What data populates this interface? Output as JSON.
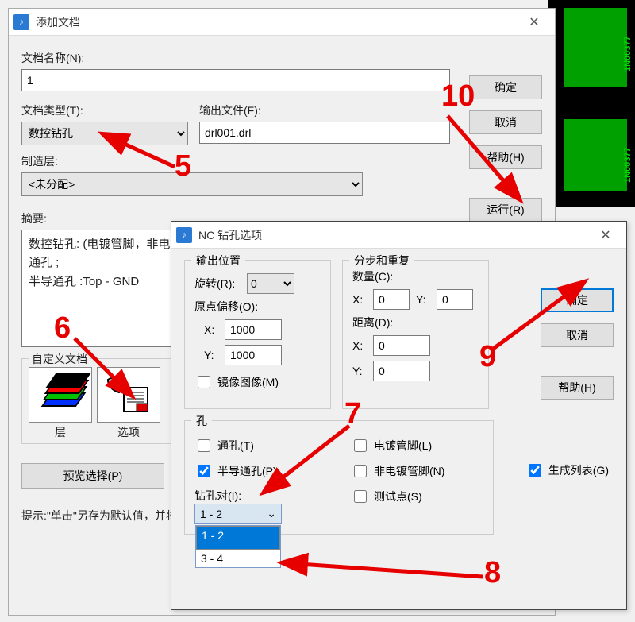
{
  "bg": {
    "component_label": "1N00377"
  },
  "dlg1": {
    "title": "添加文档",
    "labels": {
      "doc_name": "文档名称(N):",
      "doc_type": "文档类型(T):",
      "output_file": "输出文件(F):",
      "fab_layer": "制造层:",
      "summary": "摘要:",
      "custom_doc": "自定义文档",
      "layers": "层",
      "options": "选项",
      "preview": "预览选择(P)",
      "hint": "提示:\"单击\"另存为默认值，并将当前设置保存为文档类型和输出设备的默认设置。"
    },
    "fields": {
      "doc_name": "1",
      "doc_type": "数控钻孔",
      "output_file": "drl001.drl",
      "fab_layer": "<未分配>"
    },
    "summary_lines": [
      "数控钻孔: (电镀管脚，非电镀管脚，通孔，",
      "通孔 ;",
      "半导通孔 :Top - GND"
    ],
    "buttons": {
      "ok": "确定",
      "cancel": "取消",
      "help": "帮助(H)",
      "run": "运行(R)"
    }
  },
  "dlg2": {
    "title": "NC 钻孔选项",
    "groups": {
      "output_pos": "输出位置",
      "step_repeat": "分步和重复",
      "holes": "孔"
    },
    "labels": {
      "rotation": "旋转(R):",
      "origin_offset": "原点偏移(O):",
      "x": "X:",
      "y": "Y:",
      "mirror": "镜像图像(M)",
      "quantity": "数量(C):",
      "distance": "距离(D):",
      "through": "通孔(T)",
      "partial": "半导通孔(P)",
      "plated": "电镀管脚(L)",
      "nonplated": "非电镀管脚(N)",
      "testpoint": "测试点(S)",
      "gen_list": "生成列表(G)",
      "drill_pair": "钻孔对(I):"
    },
    "fields": {
      "rotation": "0",
      "origin_x": "1000",
      "origin_y": "1000",
      "qty_x": "0",
      "qty_y": "0",
      "dist_x": "0",
      "dist_y": "0",
      "drill_pair": "1 - 2",
      "drill_pair_options": [
        "1 - 2",
        "3 - 4"
      ]
    },
    "checked": {
      "mirror": false,
      "through": false,
      "partial": true,
      "plated": false,
      "nonplated": false,
      "testpoint": false,
      "gen_list": true
    },
    "buttons": {
      "ok": "确定",
      "cancel": "取消",
      "help": "帮助(H)"
    }
  },
  "annotations": {
    "5": "5",
    "6": "6",
    "7": "7",
    "8": "8",
    "9": "9",
    "10": "10"
  }
}
